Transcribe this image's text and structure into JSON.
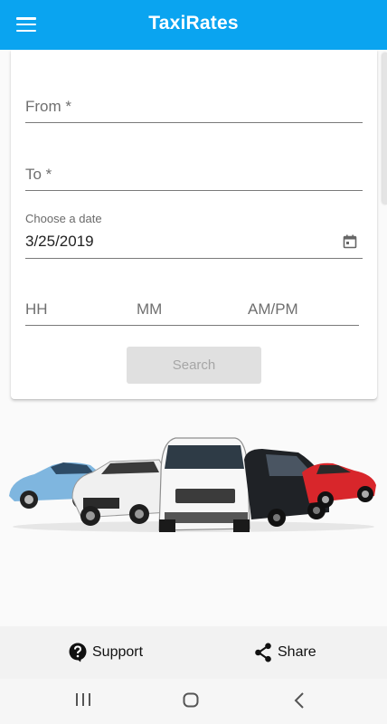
{
  "app": {
    "title": "TaxiRates"
  },
  "form": {
    "from_placeholder": "From *",
    "to_placeholder": "To *",
    "date_label": "Choose a date",
    "date_value": "3/25/2019",
    "hour_placeholder": "HH",
    "minute_placeholder": "MM",
    "ampm_placeholder": "AM/PM",
    "search_label": "Search"
  },
  "bottom_bar": {
    "support_label": "Support",
    "share_label": "Share"
  },
  "colors": {
    "app_bar": "#0aa4f0",
    "search_disabled_bg": "#e0e0e0",
    "search_disabled_text": "#a6a6a6"
  },
  "icons": {
    "menu": "hamburger-icon",
    "calendar": "calendar-icon",
    "support": "help-circle-icon",
    "share": "share-icon",
    "nav_recents": "recents-icon",
    "nav_home": "home-icon",
    "nav_back": "back-icon"
  }
}
